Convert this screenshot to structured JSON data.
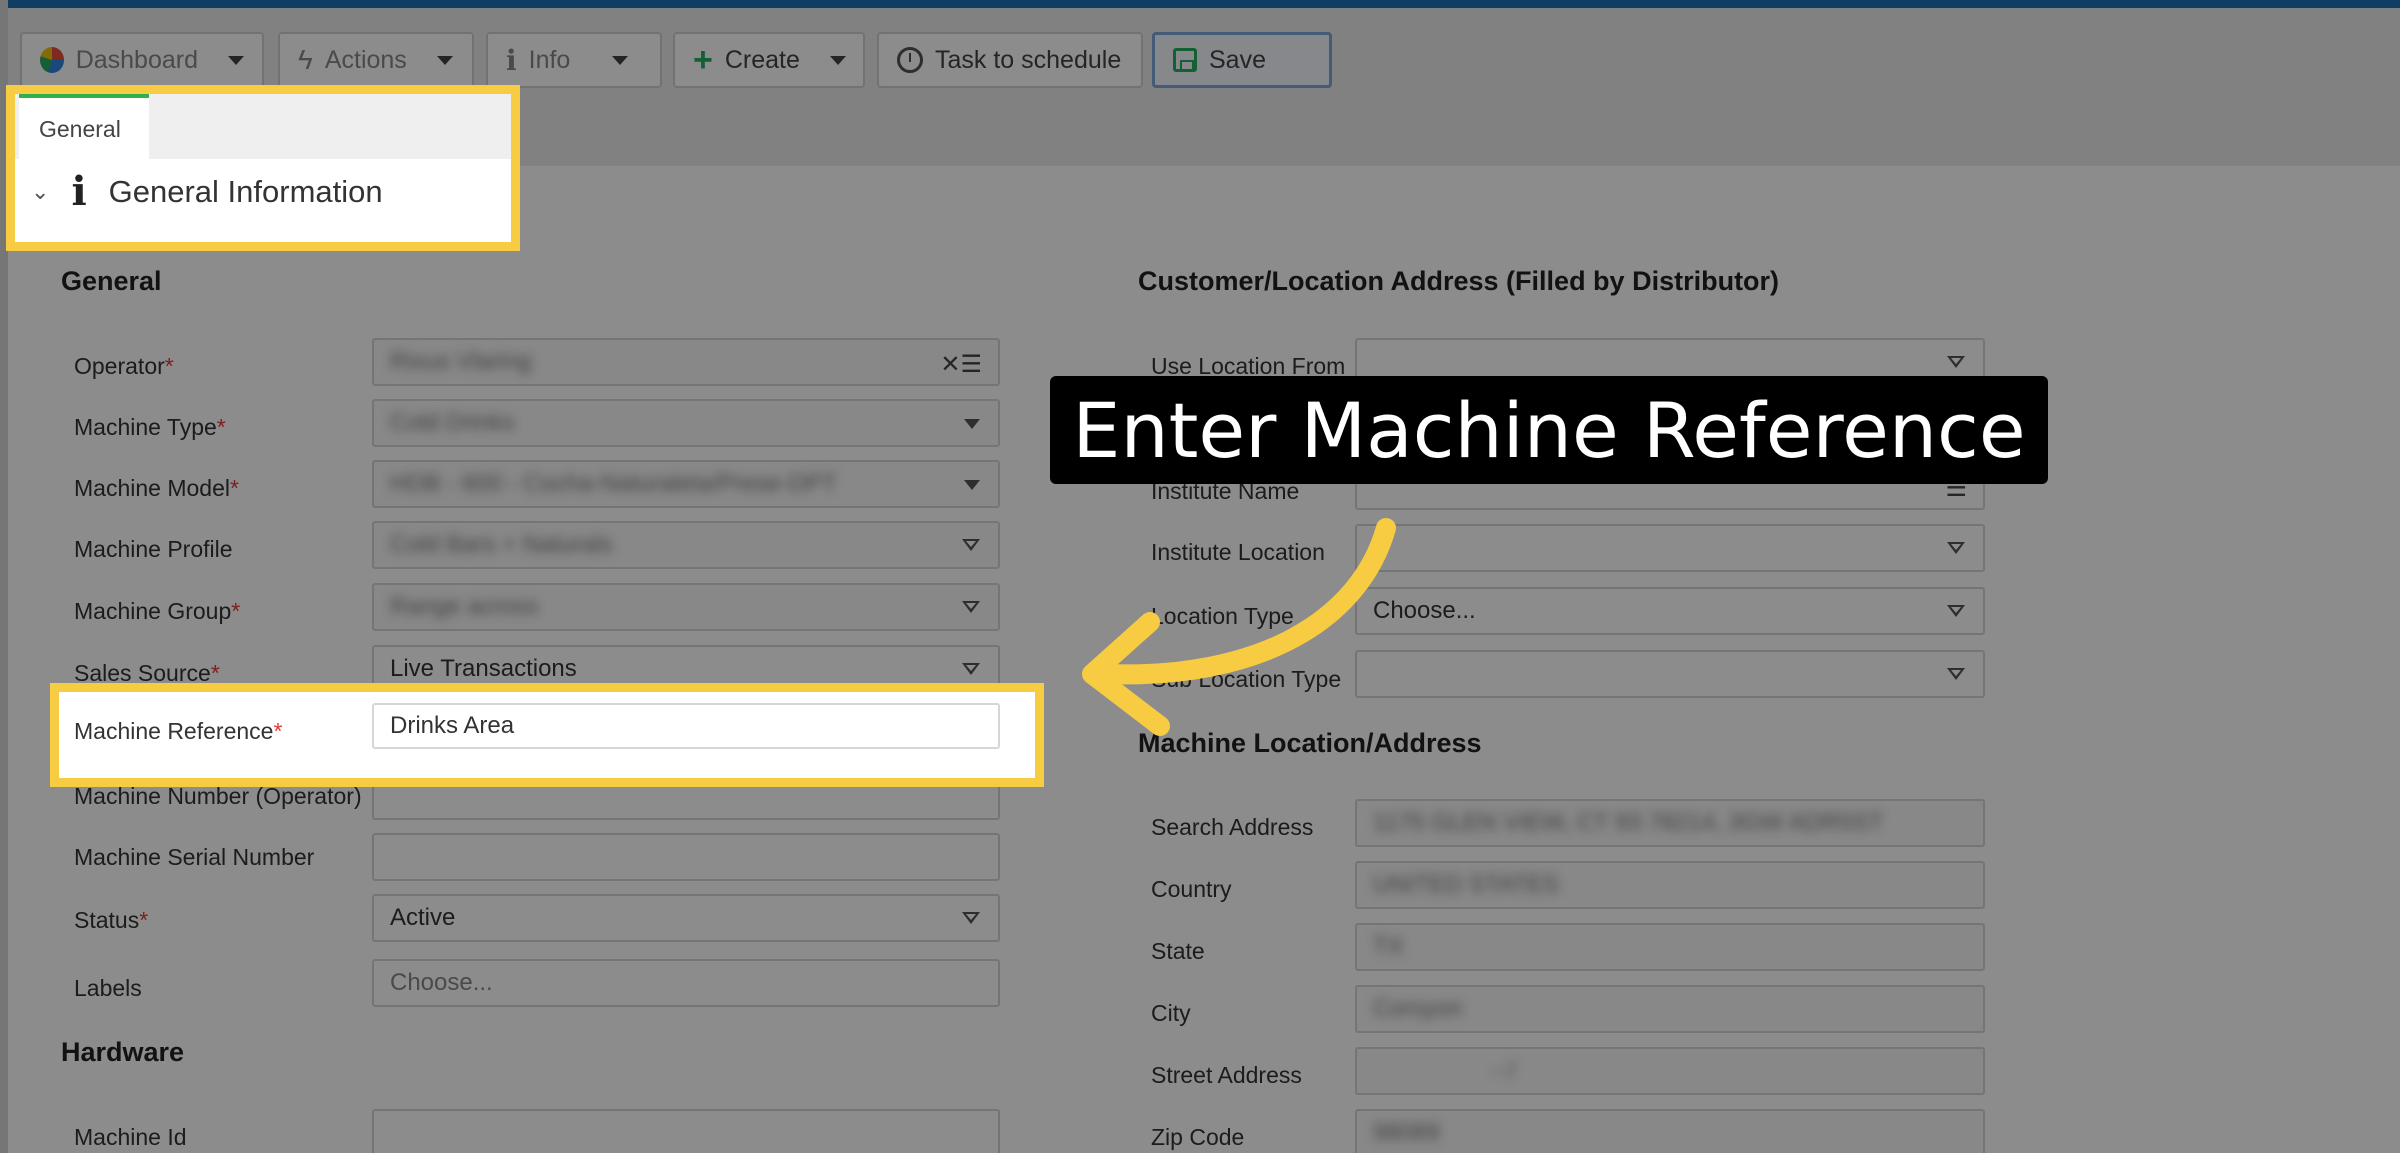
{
  "toolbar": {
    "dashboard": "Dashboard",
    "actions": "Actions",
    "info": "Info",
    "create": "Create",
    "task": "Task to schedule",
    "save": "Save"
  },
  "tabs": {
    "general": "General"
  },
  "section_header": "General Information",
  "general": {
    "title": "General",
    "operator_label": "Operator",
    "operator_value": "Rixus Vlaring",
    "machine_type_label": "Machine Type",
    "machine_type_value": "Cold Drinks",
    "machine_model_label": "Machine Model",
    "machine_model_value": "HDB - 600 - Cocha-Naturaleta/Prese-DPT",
    "machine_profile_label": "Machine Profile",
    "machine_profile_value": "Cold Bars + Naturals",
    "machine_group_label": "Machine Group",
    "machine_group_value": "Range across",
    "sales_source_label": "Sales Source",
    "sales_source_value": "Live Transactions",
    "machine_reference_label": "Machine Reference",
    "machine_reference_value": "Drinks Area",
    "machine_number_label": "Machine Number (Operator)",
    "machine_serial_label": "Machine Serial Number",
    "status_label": "Status",
    "status_value": "Active",
    "labels_label": "Labels",
    "labels_placeholder": "Choose..."
  },
  "hardware": {
    "title": "Hardware",
    "machine_id_label": "Machine Id"
  },
  "customer": {
    "title": "Customer/Location Address (Filled by Distributor)",
    "use_location_from_label": "Use Location From",
    "institute_name_label": "Institute Name",
    "institute_location_label": "Institute Location",
    "location_type_label": "Location Type",
    "location_type_value": "Choose...",
    "sub_location_type_label": "Sub Location Type"
  },
  "machine_location": {
    "title": "Machine Location/Address",
    "search_address_label": "Search Address",
    "search_address_value": "1175 GLEN VIEW, CT 93 78214, 3GW ADR5ST",
    "country_label": "Country",
    "country_value": "UNITED STATES",
    "state_label": "State",
    "state_value": "TX",
    "city_label": "City",
    "city_value": "Corsyon",
    "street_label": "Street Address",
    "street_value": "- /",
    "zip_label": "Zip Code",
    "zip_value": "98089"
  },
  "callout": "Enter Machine Reference",
  "colors": {
    "highlight": "#f8cc42",
    "accent": "#2fb14a",
    "topbar": "#1e6fb5",
    "required": "#e53935"
  }
}
